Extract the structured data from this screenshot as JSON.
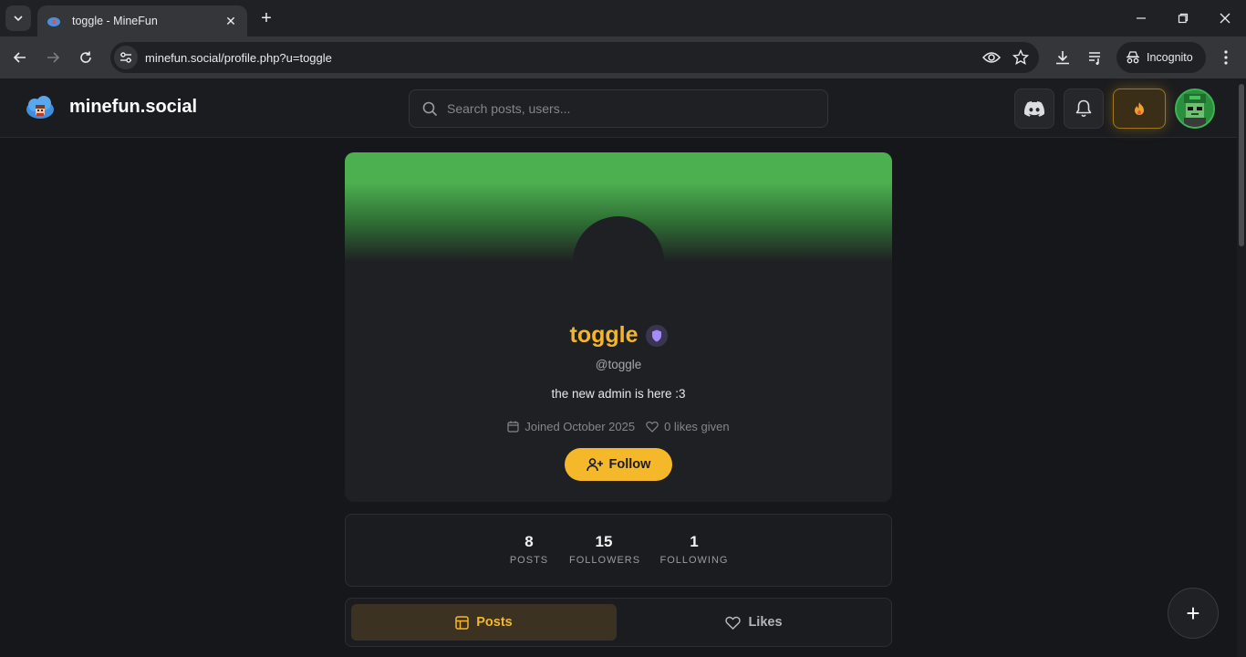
{
  "browser": {
    "tab_title": "toggle - MineFun",
    "url": "minefun.social/profile.php?u=toggle",
    "incognito_label": "Incognito"
  },
  "header": {
    "brand": "minefun.social",
    "search_placeholder": "Search posts, users..."
  },
  "profile": {
    "display_name": "toggle",
    "handle": "@toggle",
    "bio": "the new admin is here :3",
    "joined": "Joined October 2025",
    "likes_given": "0 likes given",
    "follow_label": "Follow",
    "banner_color": "#4caf50",
    "name_color": "#f5b52b"
  },
  "stats": [
    {
      "value": "8",
      "label": "POSTS"
    },
    {
      "value": "15",
      "label": "FOLLOWERS"
    },
    {
      "value": "1",
      "label": "FOLLOWING"
    }
  ],
  "tabs": [
    {
      "label": "Posts",
      "active": true
    },
    {
      "label": "Likes",
      "active": false
    }
  ],
  "fab_label": "+"
}
